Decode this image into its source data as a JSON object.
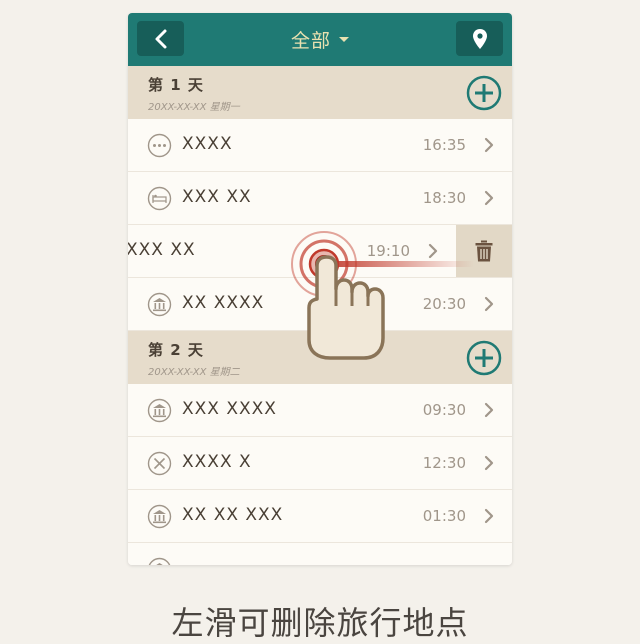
{
  "header": {
    "title": "全部",
    "back_icon": "chevron-left-icon",
    "location_icon": "location-pin-icon",
    "color": "#1f7a74"
  },
  "days": [
    {
      "label": "第 1 天",
      "date": "20XX-XX-XX 星期一",
      "items": [
        {
          "icon": "more-dots-icon",
          "name": "XXXX",
          "time": "16:35"
        },
        {
          "icon": "bed-icon",
          "name": "XXX XX",
          "time": "18:30"
        },
        {
          "icon": "landmark-icon",
          "name": "XXX XX",
          "time": "19:10"
        },
        {
          "icon": "landmark-icon",
          "name": "XX XXXX",
          "time": "20:30"
        }
      ]
    },
    {
      "label": "第 2 天",
      "date": "20XX-XX-XX 星期二",
      "items": [
        {
          "icon": "landmark-icon",
          "name": "XXX XXXX",
          "time": "09:30"
        },
        {
          "icon": "fork-knife-icon",
          "name": "XXXX X",
          "time": "12:30"
        },
        {
          "icon": "landmark-icon",
          "name": "XX XX XXX",
          "time": "01:30"
        }
      ]
    }
  ],
  "delete_icon": "trash-icon",
  "gesture": "swipe-left-hand",
  "caption": "左滑可删除旅行地点",
  "colors": {
    "accent": "#1f7a74",
    "section_bg": "#e6dccb",
    "text": "#4a4035",
    "muted": "#a0968a",
    "gesture": "#c0392b"
  }
}
